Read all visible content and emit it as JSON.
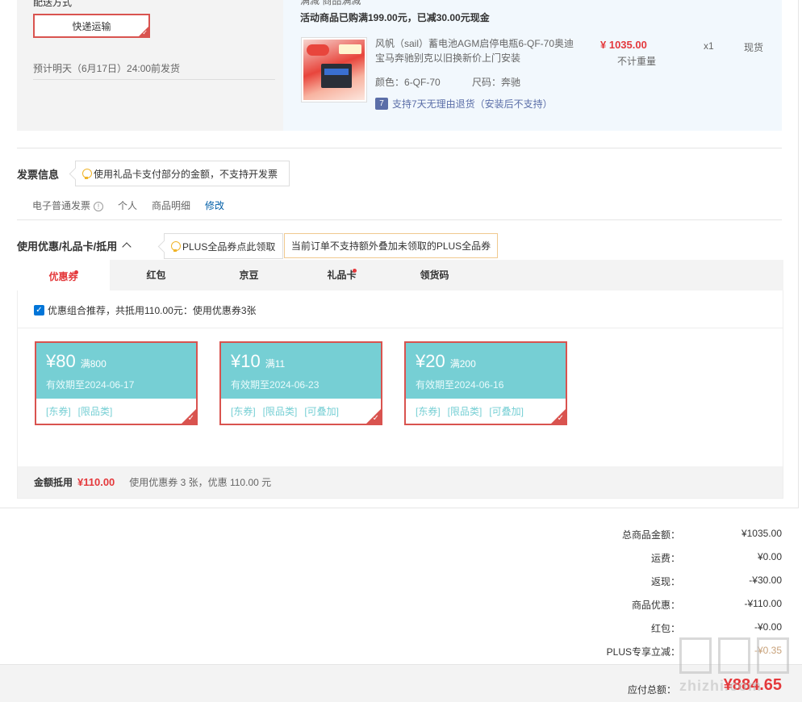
{
  "shipping": {
    "label_top": "配送方式",
    "method_button": "快递运输",
    "estimate": "预计明天（6月17日）24:00前发货"
  },
  "product": {
    "promo_top": "满减  商品满减",
    "promo": "活动商品已购满199.00元，已减30.00元现金",
    "name": "风帆（sail）蓄电池AGM启停电瓶6-QF-70奥迪宝马奔驰别克以旧换新价上门安装",
    "color_label": "颜色：",
    "color_value": "6-QF-70",
    "size_label": "尺码：",
    "size_value": "奔驰",
    "price": "¥ 1035.00",
    "weight": "不计重量",
    "qty": "x1",
    "stock": "现货",
    "return_policy": "支持7天无理由退货（安装后不支持）"
  },
  "invoice": {
    "title": "发票信息",
    "tip": "使用礼品卡支付部分的金额，不支持开发票",
    "type": "电子普通发票",
    "holder": "个人",
    "content": "商品明细",
    "modify": "修改"
  },
  "discount": {
    "title": "使用优惠/礼品卡/抵用",
    "plus_tip": "PLUS全品券点此领取",
    "plus_notice": "当前订单不支持额外叠加未领取的PLUS全品券",
    "tabs": [
      {
        "label": "优惠券",
        "dot": true
      },
      {
        "label": "红包",
        "dot": false
      },
      {
        "label": "京豆",
        "dot": false
      },
      {
        "label": "礼品卡",
        "dot": true
      },
      {
        "label": "领货码",
        "dot": false
      }
    ],
    "combo": "优惠组合推荐，共抵用110.00元：使用优惠券3张",
    "coupons": [
      {
        "amount": "¥80",
        "min": "满800",
        "expiry": "有效期至2024-06-17",
        "tags": [
          "[东券]",
          "[限品类]"
        ]
      },
      {
        "amount": "¥10",
        "min": "满11",
        "expiry": "有效期至2024-06-23",
        "tags": [
          "[东券]",
          "[限品类]",
          "[可叠加]"
        ]
      },
      {
        "amount": "¥20",
        "min": "满200",
        "expiry": "有效期至2024-06-16",
        "tags": [
          "[东券]",
          "[限品类]",
          "[可叠加]"
        ]
      }
    ],
    "summary_label": "金额抵用",
    "summary_amount": "¥110.00",
    "summary_desc": "使用优惠券 3 张，优惠 110.00 元"
  },
  "totals": [
    {
      "k": "总商品金额：",
      "v": "¥1035.00"
    },
    {
      "k": "运费：",
      "v": "¥0.00"
    },
    {
      "k": "返现：",
      "v": "-¥30.00"
    },
    {
      "k": "商品优惠：",
      "v": "-¥110.00"
    },
    {
      "k": "红包：",
      "v": "-¥0.00"
    },
    {
      "k": "PLUS专享立减：",
      "v": "-¥0.35"
    }
  ],
  "payable": {
    "label": "应付总额：",
    "value": "¥884.65"
  },
  "watermark": "zhizhi.com",
  "colors": {
    "accent": "#e4393c",
    "coupon": "#76cfd4",
    "link": "#005ea7"
  }
}
